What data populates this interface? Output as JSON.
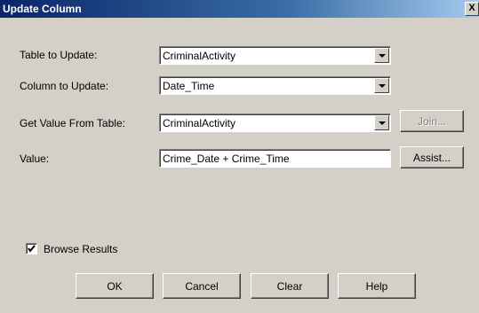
{
  "window": {
    "title": "Update Column",
    "close_label": "X"
  },
  "form": {
    "table_to_update": {
      "label": "Table to Update:",
      "value": "CriminalActivity"
    },
    "column_to_update": {
      "label": "Column to Update:",
      "value": "Date_Time"
    },
    "get_value_from_table": {
      "label": "Get Value From Table:",
      "value": "CriminalActivity"
    },
    "value": {
      "label": "Value:",
      "value": "Crime_Date + Crime_Time"
    },
    "browse_results": {
      "label": "Browse Results",
      "checked": true
    }
  },
  "buttons": {
    "join": "Join...",
    "assist": "Assist...",
    "ok": "OK",
    "cancel": "Cancel",
    "clear": "Clear",
    "help": "Help"
  },
  "colors": {
    "dialog_face": "#d4d0c8",
    "titlebar_start": "#0a246a",
    "titlebar_end": "#a6caf0",
    "disabled_text": "#808080"
  },
  "icons": {
    "dropdown": "chevron-down-icon",
    "checkbox": "checkmark-icon"
  }
}
